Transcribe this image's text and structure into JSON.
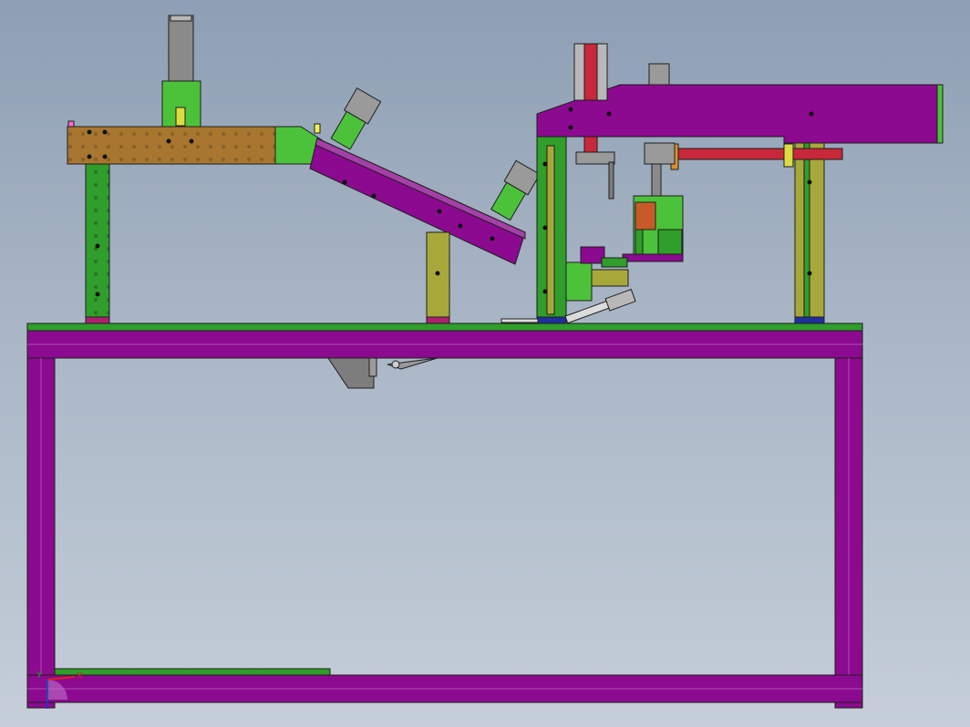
{
  "viewport": {
    "background_top": "#8e9fb4",
    "background_bottom": "#c5ced9"
  },
  "colors": {
    "frame_purple": "#8b0a8f",
    "plate_green": "#2f9e2a",
    "bright_green": "#4cc23a",
    "olive": "#a8a83a",
    "brown": "#a8762e",
    "gray": "#9a9a9a",
    "red_rod": "#c8283a",
    "edge": "#1e1e1e"
  },
  "triad": {
    "x_label": "X",
    "y_label": "Y",
    "x_color": "#e02020",
    "y_color": "#20a020",
    "z_color": "#2030e0"
  }
}
